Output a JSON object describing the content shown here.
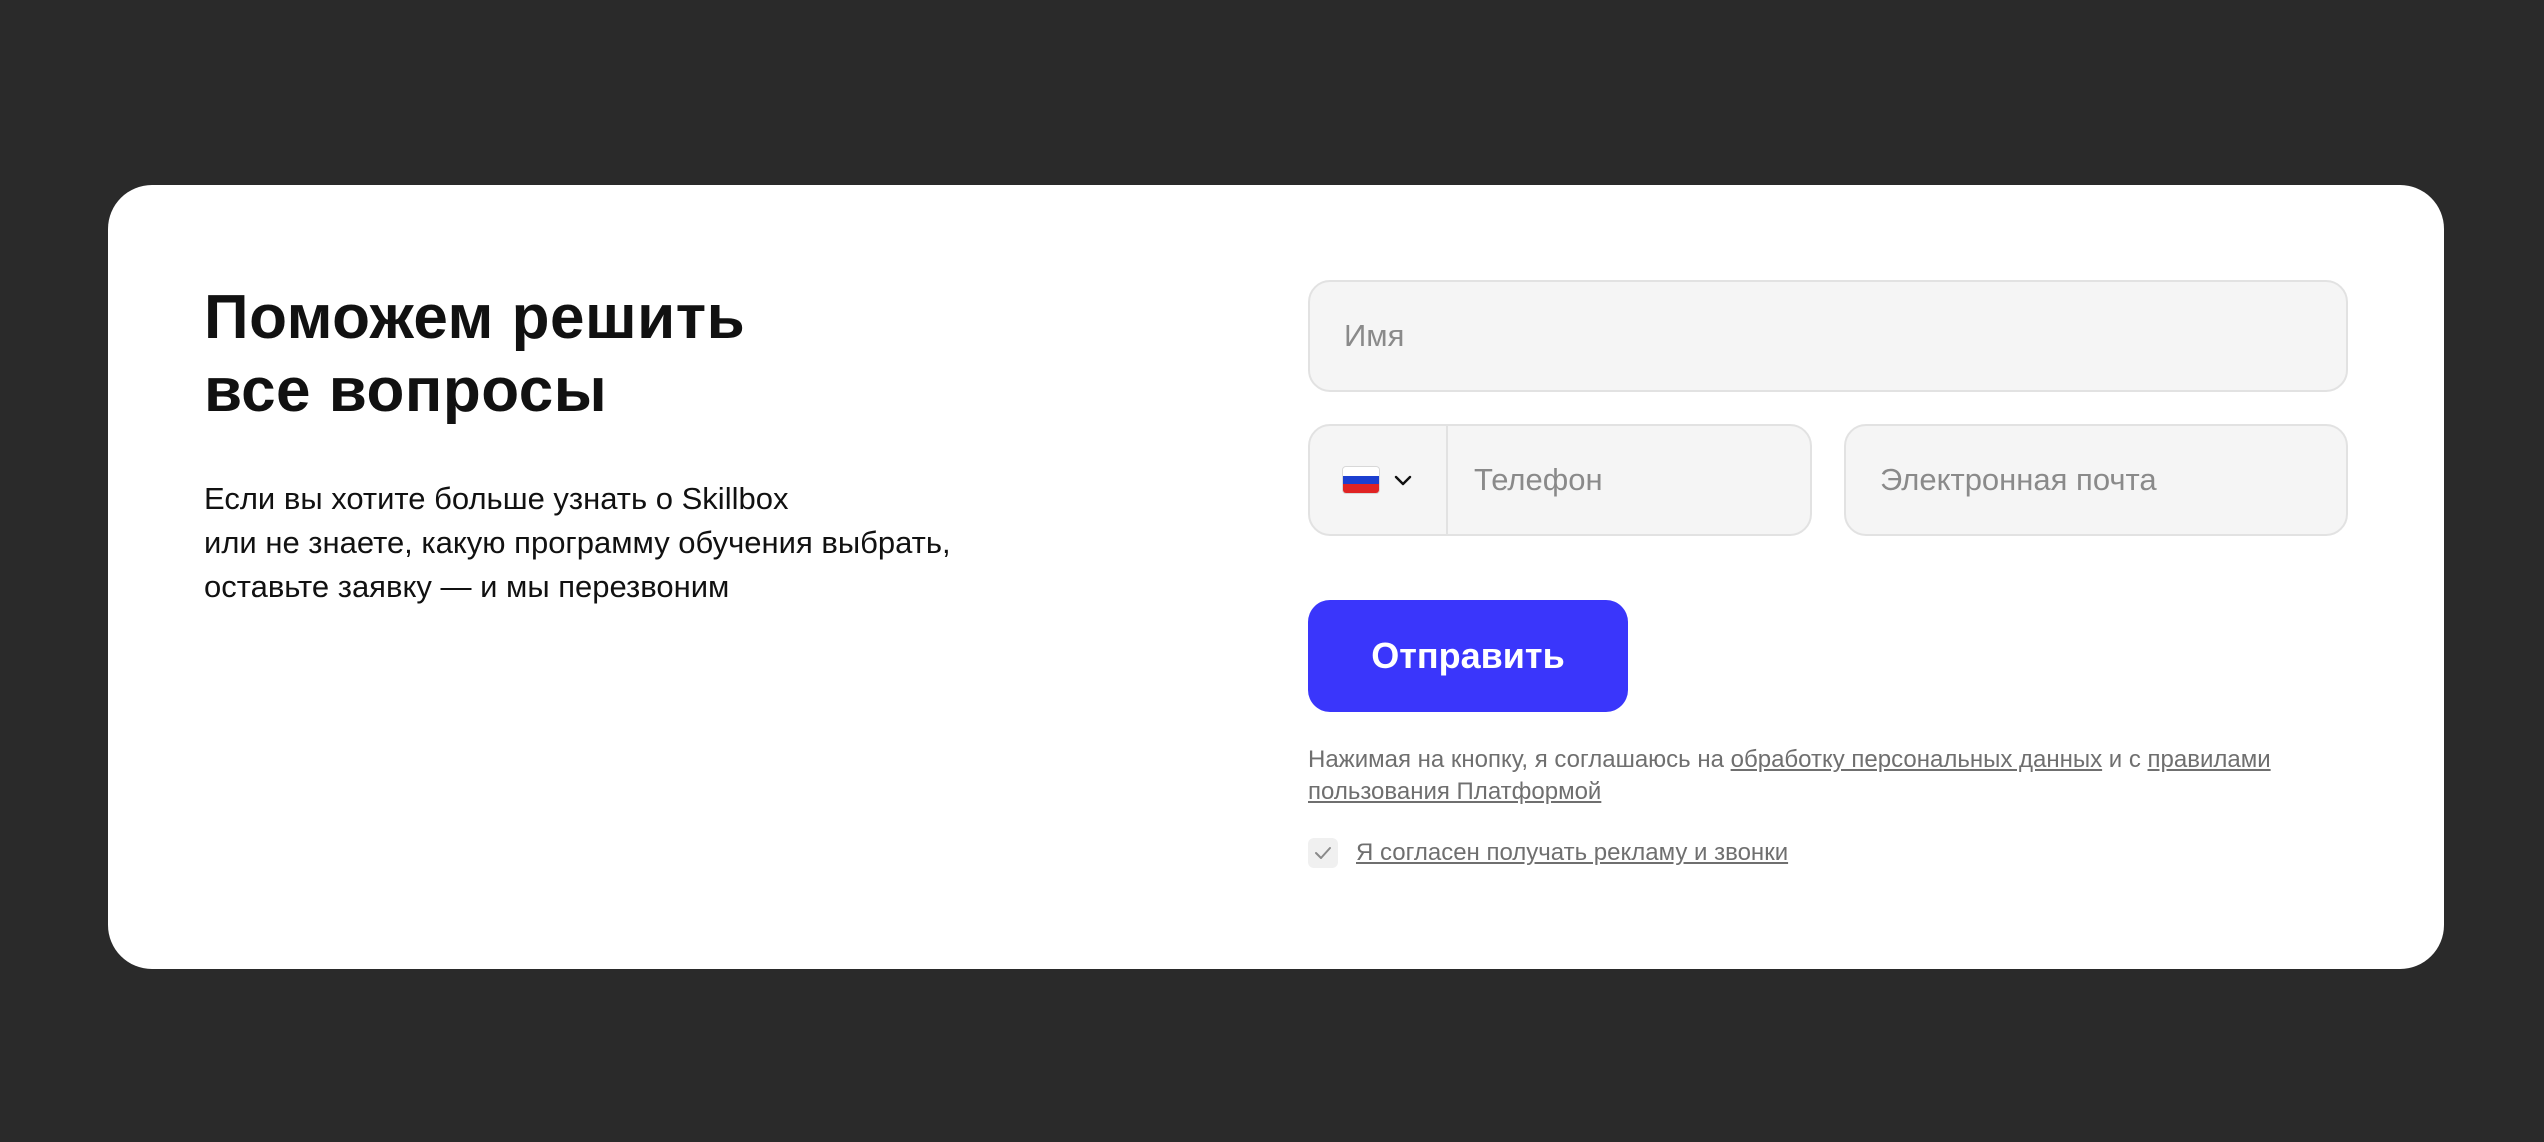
{
  "header": {
    "title_line1": "Поможем решить",
    "title_line2": "все вопросы"
  },
  "intro": {
    "line1": "Если вы хотите больше узнать о Skillbox",
    "line2": "или не знаете, какую программу обучения выбрать,",
    "line3": "оставьте заявку — и мы перезвоним"
  },
  "form": {
    "name_placeholder": "Имя",
    "country_flag_icon": "russia-flag-icon",
    "phone_placeholder": "Телефон",
    "email_placeholder": "Электронная почта",
    "submit_label": "Отправить"
  },
  "legal": {
    "prefix": "Нажимая на кнопку, я соглашаюсь на ",
    "personal_data_link": "обработку персональных данных",
    "middle": " и с ",
    "rules_link": "правилами пользования Платформой"
  },
  "consent": {
    "checked": true,
    "label": "Я согласен получать рекламу и звонки"
  },
  "colors": {
    "background": "#2a2a2a",
    "card": "#ffffff",
    "accent": "#3a36fb",
    "field_bg": "#f5f5f5"
  }
}
